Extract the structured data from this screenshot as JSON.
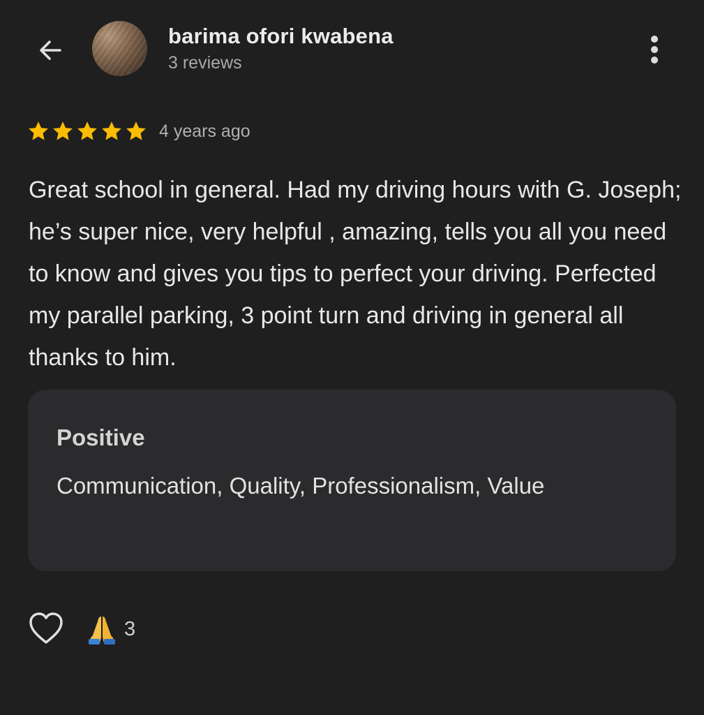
{
  "header": {
    "back_icon": "arrow-left-icon",
    "user_name": "barima ofori kwabena",
    "review_count": "3 reviews",
    "more_icon": "more-vert-icon"
  },
  "review": {
    "rating": 5,
    "rating_max": 5,
    "star_color": "#fbbc04",
    "time_ago": "4 years ago",
    "text": "Great school in general. Had my driving hours with G. Joseph; he’s super nice, very helpful , amazing, tells you all you need to know and gives you tips to perfect your driving. Perfected my parallel parking, 3 point turn and driving in general all thanks to him."
  },
  "attributes": {
    "title": "Positive",
    "values": "Communication, Quality, Professionalism, Value"
  },
  "actions": {
    "like_icon": "heart-outline-icon",
    "reaction_icon": "folded-hands-icon",
    "reaction_count": "3"
  },
  "colors": {
    "background": "#1f1f20",
    "card": "#2b2b2d",
    "star": "#fbbc04"
  }
}
